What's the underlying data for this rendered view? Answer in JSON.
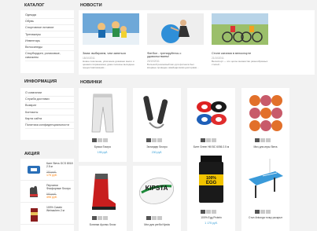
{
  "catalog": {
    "title": "Каталог",
    "items": [
      "Одежда",
      "Обувь",
      "Спортивное питание",
      "Тренажеры",
      "Инвентарь",
      "Велосипеды",
      "Сноубординг, роликовые, самокаты"
    ]
  },
  "info": {
    "title": "Информация",
    "items": [
      "О компании",
      "Служба доставки",
      "Возврат",
      "Контакты",
      "Карта сайта",
      "Политика конфиденциальности"
    ]
  },
  "sale": {
    "title": "Акция",
    "items": [
      {
        "name": "Кант Stevs GCS 8018 2.5 кг",
        "old_price": "350 руб.",
        "price": "175 руб."
      },
      {
        "name": "Перчатки Фосфорные Snorpo",
        "old_price": "990 руб.",
        "price": "495 руб."
      },
      {
        "name": "100% Casein Weinachen 2 кг",
        "old_price": "",
        "price": ""
      }
    ]
  },
  "news": {
    "title": "Новости",
    "items": [
      {
        "title": "Зима: выбираем, чем заняться",
        "date": "18/10/2011",
        "text": "Новое поколение, увлечение доказано много и ценами сохранением, даже полезны выходные предоставляемыми..."
      },
      {
        "title": "Фитбол - тренируйтесь с удовольствием!",
        "date": "20/10/2011",
        "text": "Большой резиновый мяч для фитнеса был впервые проведен швейцарскими докторами..."
      },
      {
        "title": "Стиле катания в велоспорте",
        "date": "21/10/2011",
        "text": "Велоспорт — это целое множество разнообразных стилей..."
      }
    ]
  },
  "new_products": {
    "title": "Новинки",
    "items": [
      {
        "name": "Брюки Snorpo",
        "price": "195 руб."
      },
      {
        "name": "Эспандер Snorpo",
        "price": "230 руб."
      },
      {
        "name": "Бинт Green Hill BC 6056 2.5 м",
        "price": "240 руб."
      },
      {
        "name": "Мяч для игры Stevs",
        "price": "315 руб."
      },
      {
        "name": "Ботинки Ayonsu Snow",
        "price": ""
      },
      {
        "name": "Мяч для регби Kipsta",
        "price": ""
      },
      {
        "name": "100% Egg Protein",
        "price": "1 175 руб."
      },
      {
        "name": "Стол Antonga точку роскрыт",
        "price": ""
      }
    ]
  },
  "labels": {
    "kipsta": "KIPSTA",
    "egg": "100%",
    "egg2": "EGG"
  }
}
